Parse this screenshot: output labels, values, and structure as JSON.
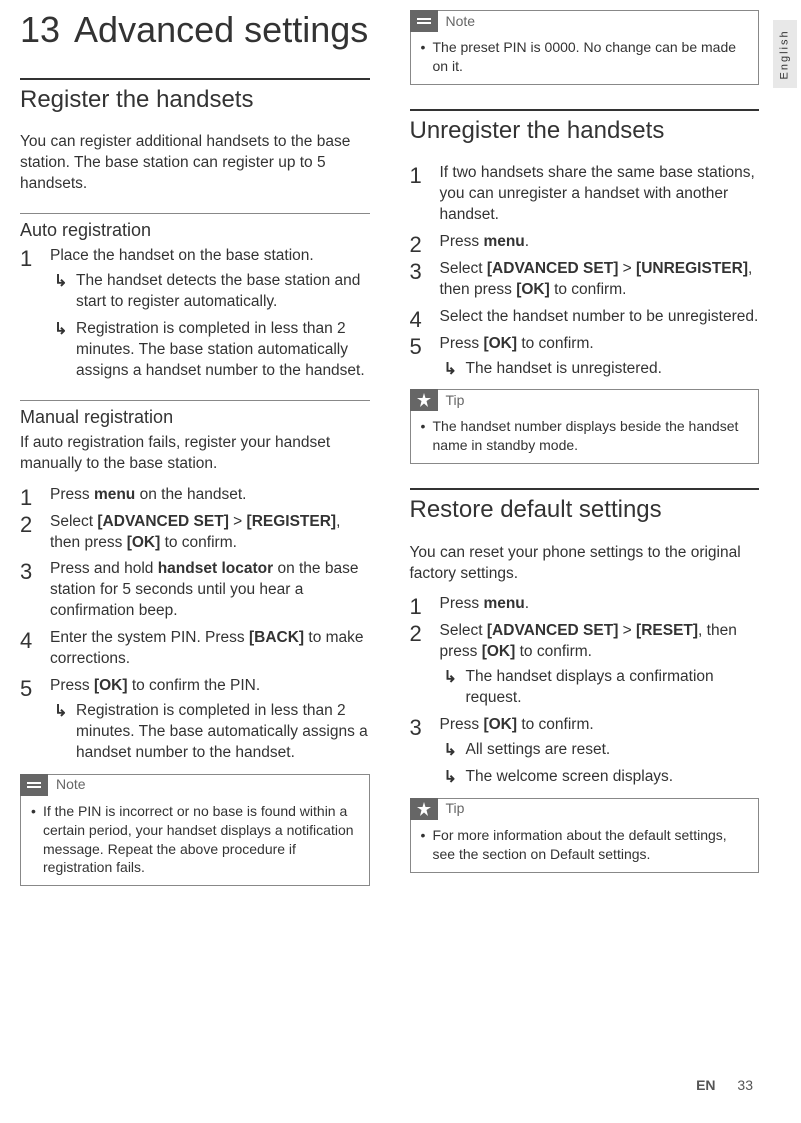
{
  "side_tab": "English",
  "chapter": {
    "num": "13",
    "title": "Advanced settings"
  },
  "left": {
    "s1": {
      "title": "Register the handsets",
      "intro": "You can register additional handsets to the base station. The base station can register up to 5 handsets.",
      "auto": {
        "title": "Auto registration",
        "step1": "Place the handset on the base station.",
        "r1": "The handset detects the base station and start to register automatically.",
        "r2": "Registration is completed in less than 2 minutes. The base station automatically assigns a handset number to the handset."
      },
      "manual": {
        "title": "Manual registration",
        "intro": "If auto registration fails, register your handset manually to the base station.",
        "step1_a": "Press ",
        "step1_b": "menu",
        "step1_c": " on the handset.",
        "step2_a": "Select ",
        "step2_b": "[ADVANCED SET]",
        "step2_c": " > ",
        "step2_d": "[REGISTER]",
        "step2_e": ", then press ",
        "step2_f": "[OK]",
        "step2_g": " to confirm.",
        "step3_a": "Press and hold ",
        "step3_b": "handset locator",
        "step3_c": " on the base station for 5 seconds until you hear a confirmation beep.",
        "step4_a": "Enter the system PIN. Press ",
        "step4_b": "[BACK]",
        "step4_c": " to make corrections.",
        "step5_a": "Press ",
        "step5_b": "[OK]",
        "step5_c": " to confirm the PIN.",
        "r1": "Registration is completed in less than 2 minutes. The base automatically assigns a handset number to the handset."
      },
      "note_label": "Note",
      "note": "If the PIN is incorrect or no base is found within a certain period, your handset displays a notification message. Repeat the above procedure if registration fails."
    }
  },
  "right": {
    "top_note_label": "Note",
    "top_note": "The preset PIN is 0000. No change can be made on it.",
    "s2": {
      "title": "Unregister the handsets",
      "step1": "If two handsets share the same base stations, you can unregister a handset with another handset.",
      "step2_a": "Press ",
      "step2_b": "menu",
      "step2_c": ".",
      "step3_a": "Select ",
      "step3_b": "[ADVANCED SET]",
      "step3_c": " > ",
      "step3_d": "[UNREGISTER]",
      "step3_e": ", then press ",
      "step3_f": "[OK]",
      "step3_g": " to confirm.",
      "step4": "Select the handset number to be unregistered.",
      "step5_a": "Press ",
      "step5_b": "[OK]",
      "step5_c": " to confirm.",
      "r1": "The handset is unregistered.",
      "tip_label": "Tip",
      "tip": "The handset number displays beside the handset name in standby mode."
    },
    "s3": {
      "title": "Restore default settings",
      "intro": "You can reset your phone settings to the original factory settings.",
      "step1_a": "Press ",
      "step1_b": "menu",
      "step1_c": ".",
      "step2_a": "Select ",
      "step2_b": "[ADVANCED SET]",
      "step2_c": " > ",
      "step2_d": "[RESET]",
      "step2_e": ", then press ",
      "step2_f": "[OK]",
      "step2_g": " to confirm.",
      "r2a": "The handset displays a confirmation request.",
      "step3_a": "Press ",
      "step3_b": "[OK]",
      "step3_c": " to confirm.",
      "r3a": "All settings are reset.",
      "r3b": "The welcome screen displays.",
      "tip_label": "Tip",
      "tip": "For more information about the default settings, see the section on Default settings."
    }
  },
  "footer": {
    "lang": "EN",
    "page": "33"
  }
}
